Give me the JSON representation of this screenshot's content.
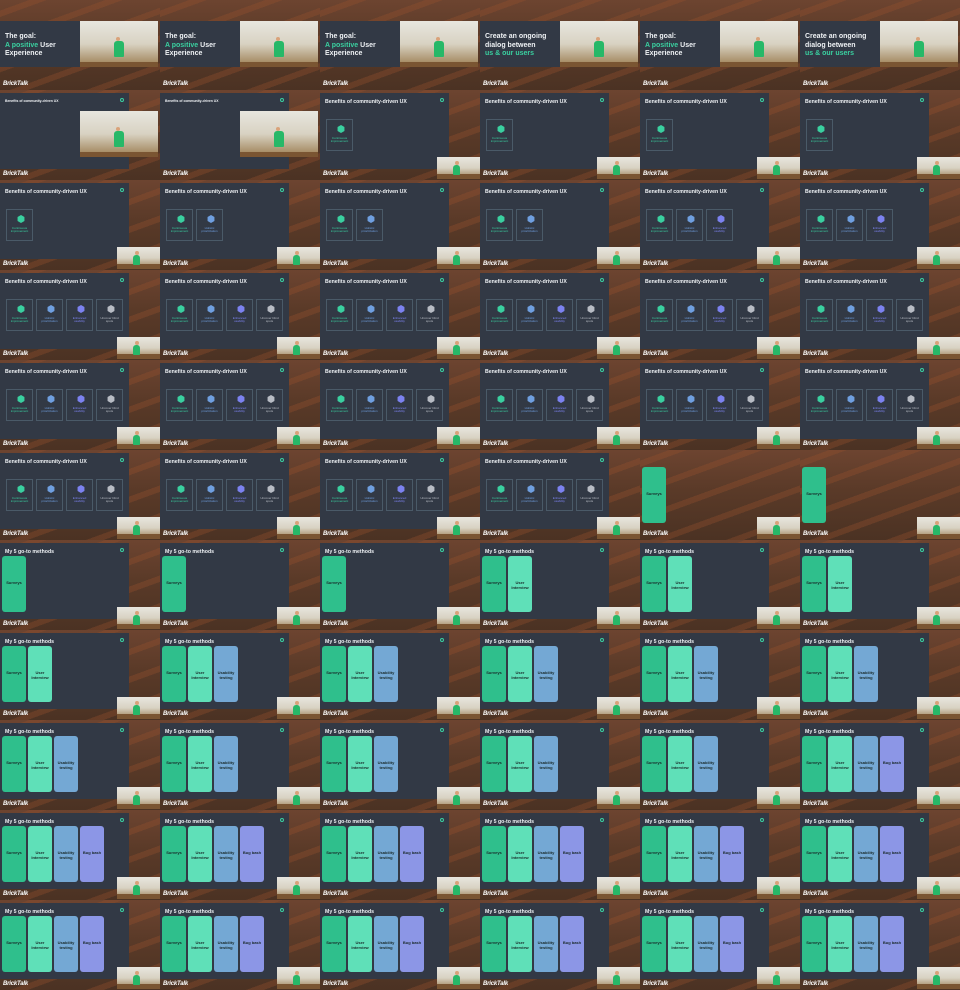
{
  "slides": {
    "goal": {
      "title_before": "The goal:",
      "title_accent": "A positive",
      "title_after": "User Experience"
    },
    "dialog": {
      "title_line1": "Create an ongoing",
      "title_line2": "dialog between",
      "title_accent": "us & our users"
    },
    "benefits": {
      "title": "Benefits of community-driven UX"
    },
    "methods": {
      "title": "My 5 go-to methods"
    }
  },
  "benefit_steps": [
    {
      "label": "Continuous improvement",
      "color": "#3ad0a0"
    },
    {
      "label": "Holistic prioritization",
      "color": "#6f9fe0"
    },
    {
      "label": "Enhanced usability",
      "color": "#7c82f0"
    },
    {
      "label": "Uncover blind spots",
      "color": "#b8bcc4"
    }
  ],
  "method_cards": [
    {
      "label": "Surveys",
      "color": "#2fbf8c"
    },
    {
      "label": "User Interview",
      "color": "#5fe0b8"
    },
    {
      "label": "Usability testing",
      "color": "#74a8d4"
    },
    {
      "label": "Bug bash",
      "color": "#8c96e6"
    }
  ],
  "logo_text": "BrickTalk",
  "frames": [
    {
      "kind": "goal"
    },
    {
      "kind": "goal"
    },
    {
      "kind": "goal"
    },
    {
      "kind": "dialog"
    },
    {
      "kind": "goal"
    },
    {
      "kind": "dialog"
    },
    {
      "kind": "benefits",
      "n": 0,
      "camBig": true
    },
    {
      "kind": "benefits",
      "n": 0,
      "camBig": true
    },
    {
      "kind": "benefits",
      "n": 1
    },
    {
      "kind": "benefits",
      "n": 1
    },
    {
      "kind": "benefits",
      "n": 1
    },
    {
      "kind": "benefits",
      "n": 1
    },
    {
      "kind": "benefits",
      "n": 1
    },
    {
      "kind": "benefits",
      "n": 2
    },
    {
      "kind": "benefits",
      "n": 2
    },
    {
      "kind": "benefits",
      "n": 2
    },
    {
      "kind": "benefits",
      "n": 3
    },
    {
      "kind": "benefits",
      "n": 3
    },
    {
      "kind": "benefits",
      "n": 4
    },
    {
      "kind": "benefits",
      "n": 4
    },
    {
      "kind": "benefits",
      "n": 4
    },
    {
      "kind": "benefits",
      "n": 4
    },
    {
      "kind": "benefits",
      "n": 4
    },
    {
      "kind": "benefits",
      "n": 4
    },
    {
      "kind": "benefits",
      "n": 4
    },
    {
      "kind": "benefits",
      "n": 4
    },
    {
      "kind": "benefits",
      "n": 4
    },
    {
      "kind": "benefits",
      "n": 4
    },
    {
      "kind": "benefits",
      "n": 4
    },
    {
      "kind": "benefits",
      "n": 4
    },
    {
      "kind": "benefits",
      "n": 4
    },
    {
      "kind": "benefits",
      "n": 4
    },
    {
      "kind": "benefits",
      "n": 4
    },
    {
      "kind": "benefits",
      "n": 4
    },
    {
      "kind": "methods",
      "n": 1,
      "noTitle": true
    },
    {
      "kind": "methods",
      "n": 1,
      "noTitle": true
    },
    {
      "kind": "methods",
      "n": 1
    },
    {
      "kind": "methods",
      "n": 1
    },
    {
      "kind": "methods",
      "n": 1
    },
    {
      "kind": "methods",
      "n": 2
    },
    {
      "kind": "methods",
      "n": 2
    },
    {
      "kind": "methods",
      "n": 2
    },
    {
      "kind": "methods",
      "n": 2
    },
    {
      "kind": "methods",
      "n": 3
    },
    {
      "kind": "methods",
      "n": 3
    },
    {
      "kind": "methods",
      "n": 3
    },
    {
      "kind": "methods",
      "n": 3
    },
    {
      "kind": "methods",
      "n": 3
    },
    {
      "kind": "methods",
      "n": 3
    },
    {
      "kind": "methods",
      "n": 3
    },
    {
      "kind": "methods",
      "n": 3
    },
    {
      "kind": "methods",
      "n": 3
    },
    {
      "kind": "methods",
      "n": 3
    },
    {
      "kind": "methods",
      "n": 4
    },
    {
      "kind": "methods",
      "n": 4
    },
    {
      "kind": "methods",
      "n": 4
    },
    {
      "kind": "methods",
      "n": 4
    },
    {
      "kind": "methods",
      "n": 4
    },
    {
      "kind": "methods",
      "n": 4
    },
    {
      "kind": "methods",
      "n": 4
    },
    {
      "kind": "methods",
      "n": 4
    },
    {
      "kind": "methods",
      "n": 4
    },
    {
      "kind": "methods",
      "n": 4
    },
    {
      "kind": "methods",
      "n": 4
    },
    {
      "kind": "methods",
      "n": 4
    },
    {
      "kind": "methods",
      "n": 4
    }
  ]
}
